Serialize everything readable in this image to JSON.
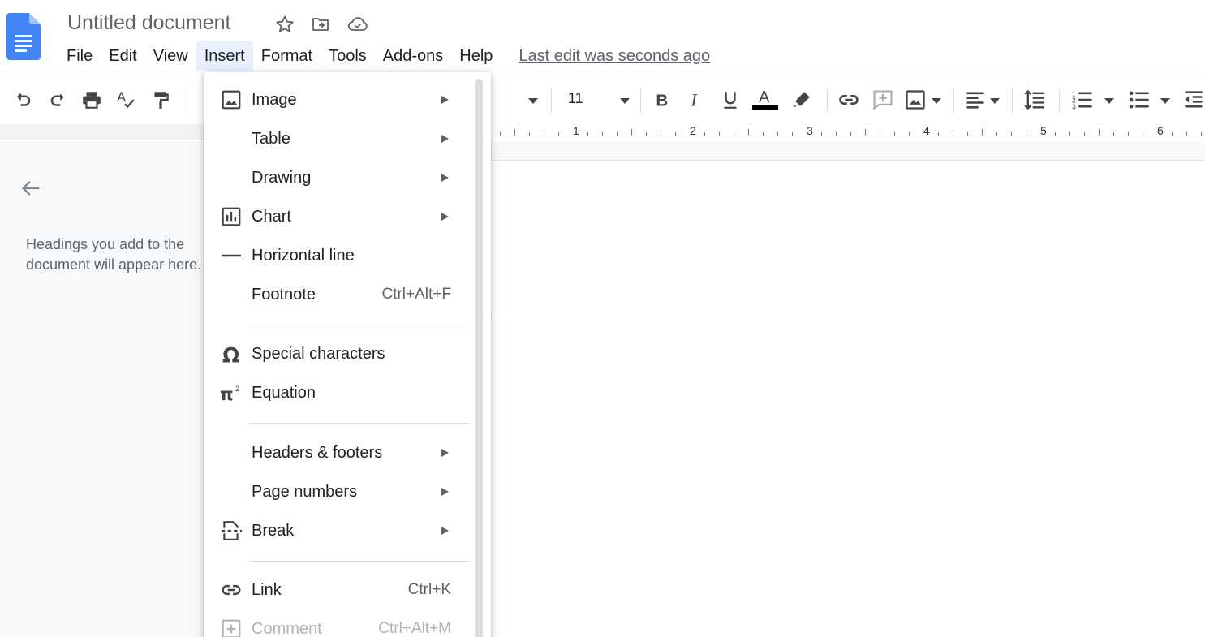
{
  "app": {
    "title": "Untitled document",
    "last_edit": "Last edit was seconds ago"
  },
  "menubar": [
    {
      "label": "File"
    },
    {
      "label": "Edit"
    },
    {
      "label": "View"
    },
    {
      "label": "Insert",
      "active": true
    },
    {
      "label": "Format"
    },
    {
      "label": "Tools"
    },
    {
      "label": "Add-ons"
    },
    {
      "label": "Help"
    }
  ],
  "toolbar": {
    "font_size": "11",
    "text_color": "#000000"
  },
  "ruler": {
    "numbers": [
      "1",
      "2",
      "3",
      "4",
      "5",
      "6"
    ]
  },
  "outline": {
    "placeholder": "Headings you add to the document will appear here."
  },
  "insert_menu": {
    "items": [
      {
        "label": "Image",
        "icon": "image-icon",
        "submenu": true
      },
      {
        "label": "Table",
        "icon": "",
        "submenu": true
      },
      {
        "label": "Drawing",
        "icon": "",
        "submenu": true
      },
      {
        "label": "Chart",
        "icon": "chart-icon",
        "submenu": true
      },
      {
        "label": "Horizontal line",
        "icon": "horizontal-line-icon",
        "submenu": false
      },
      {
        "label": "Footnote",
        "icon": "",
        "shortcut": "Ctrl+Alt+F",
        "submenu": false
      },
      {
        "label": "Special characters",
        "icon": "omega-icon",
        "submenu": false
      },
      {
        "label": "Equation",
        "icon": "pi-icon",
        "submenu": false
      },
      {
        "label": "Headers & footers",
        "icon": "",
        "submenu": true
      },
      {
        "label": "Page numbers",
        "icon": "",
        "submenu": true
      },
      {
        "label": "Break",
        "icon": "page-break-icon",
        "submenu": true
      },
      {
        "label": "Link",
        "icon": "link-icon",
        "shortcut": "Ctrl+K",
        "submenu": false
      },
      {
        "label": "Comment",
        "icon": "add-comment-icon",
        "shortcut": "Ctrl+Alt+M",
        "submenu": false,
        "disabled": true
      }
    ]
  }
}
